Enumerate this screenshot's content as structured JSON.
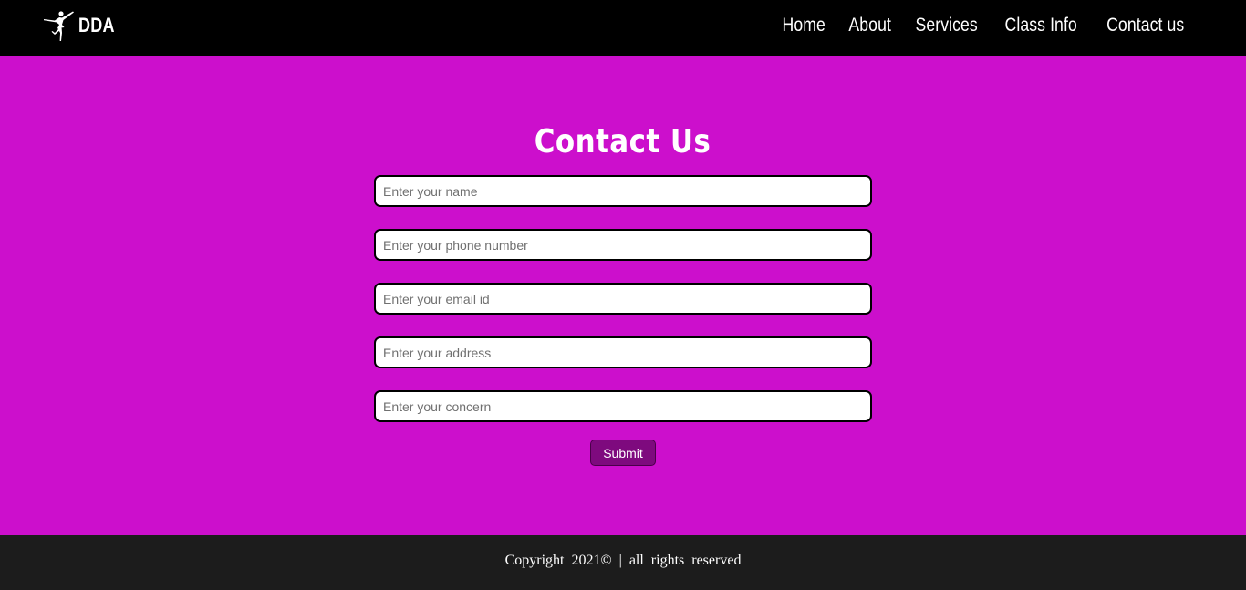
{
  "header": {
    "brand": {
      "logo_icon": "ballerina-icon",
      "name": "DDA"
    },
    "nav": [
      {
        "label": "Home"
      },
      {
        "label": "About"
      },
      {
        "label": "Services"
      },
      {
        "label": "Class Info"
      },
      {
        "label": "Contact us"
      }
    ]
  },
  "contact": {
    "title": "Contact Us",
    "fields": [
      {
        "placeholder": "Enter your name",
        "value": ""
      },
      {
        "placeholder": "Enter your phone number",
        "value": ""
      },
      {
        "placeholder": "Enter your email id",
        "value": ""
      },
      {
        "placeholder": "Enter your address",
        "value": ""
      },
      {
        "placeholder": "Enter your concern",
        "value": ""
      }
    ],
    "submit_label": "Submit"
  },
  "footer": {
    "text": "Copyright 2021© | all rights reserved"
  },
  "colors": {
    "navbar_bg": "#000000",
    "main_bg": "#cc0fcc",
    "submit_bg": "#7e0a7e",
    "footer_bg": "#1c1c1c",
    "text": "#ffffff"
  }
}
